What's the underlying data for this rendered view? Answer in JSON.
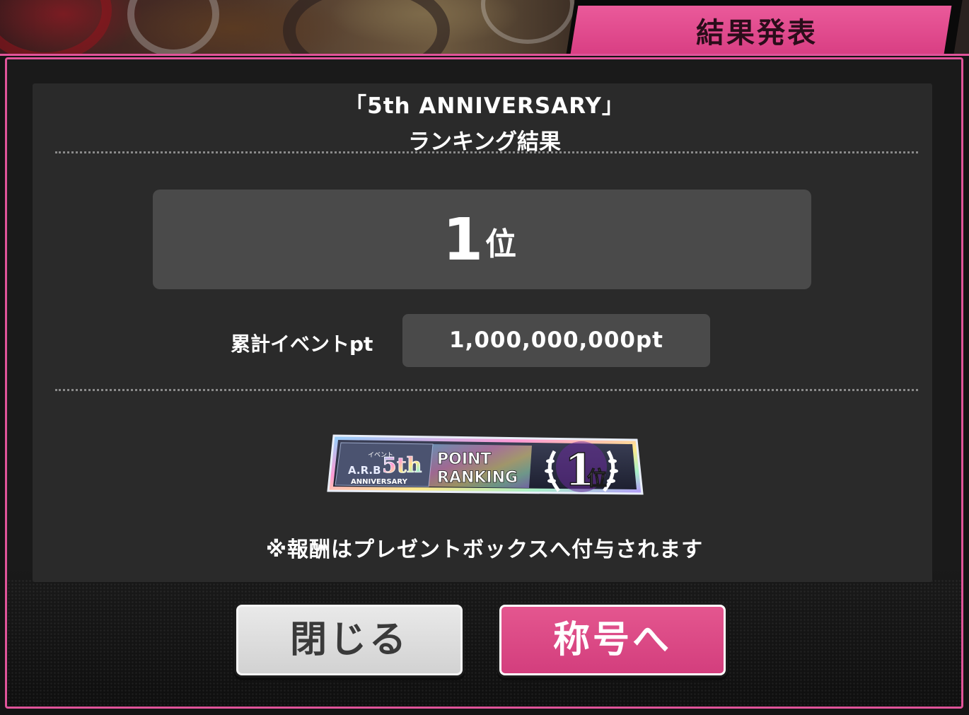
{
  "header": {
    "tab_label": "結果発表"
  },
  "result": {
    "event_title": "「5th ANNIVERSARY」",
    "subtitle": "ランキング結果",
    "rank_number": "1",
    "rank_suffix": "位",
    "points_label": "累計イベントpt",
    "points_value": "1,000,000,000pt"
  },
  "badge": {
    "event_small": "イベント",
    "brand": "A.R.B",
    "anniversary_big": "5th",
    "anniversary_word": "ANNIVERSARY",
    "point_word": "POINT",
    "ranking_word": "RANKING",
    "rank_number": "1",
    "rank_suffix": "位",
    "colors": {
      "frame": "#cfd8e8",
      "holo_a": "#8fd3ff",
      "holo_b": "#ff9ad5",
      "holo_c": "#ffe98a",
      "accent": "#7a2fb0"
    },
    "icon": "laurel-wreath-icon"
  },
  "notice": "※報酬はプレゼントボックスへ付与されます",
  "buttons": {
    "close_label": "閉じる",
    "title_label": "称号へ"
  },
  "colors": {
    "accent_pink": "#e0549a",
    "panel": "#2a2a2a",
    "value_box": "#4a4a4a"
  }
}
